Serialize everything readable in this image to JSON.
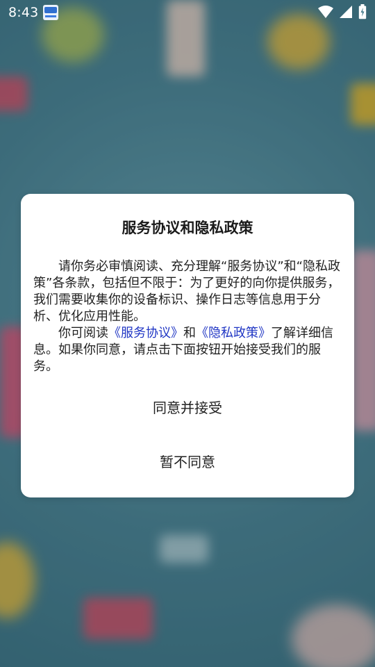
{
  "status_bar": {
    "time": "8:43",
    "icons": [
      "app-notification-icon",
      "wifi-icon",
      "cellular-signal-icon",
      "battery-charging-icon"
    ]
  },
  "dialog": {
    "title": "服务协议和隐私政策",
    "paragraph1": "请你务必审慎阅读、充分理解“服务协议”和“隐私政策”各条款，包括但不限于：为了更好的向你提供服务，我们需要收集你的设备标识、操作日志等信息用于分析、优化应用性能。",
    "paragraph2_prefix": "你可阅读",
    "service_agreement_link": "《服务协议》",
    "paragraph2_and": "和",
    "privacy_policy_link": "《隐私政策》",
    "paragraph2_suffix": "了解详细信息。如果你同意，请点击下面按钮开始接受我们的服务。",
    "agree_label": "同意并接受",
    "decline_label": "暂不同意"
  },
  "colors": {
    "link": "#2036c4",
    "dialog_bg": "#ffffff",
    "background_teal": "#4f8d9c"
  }
}
